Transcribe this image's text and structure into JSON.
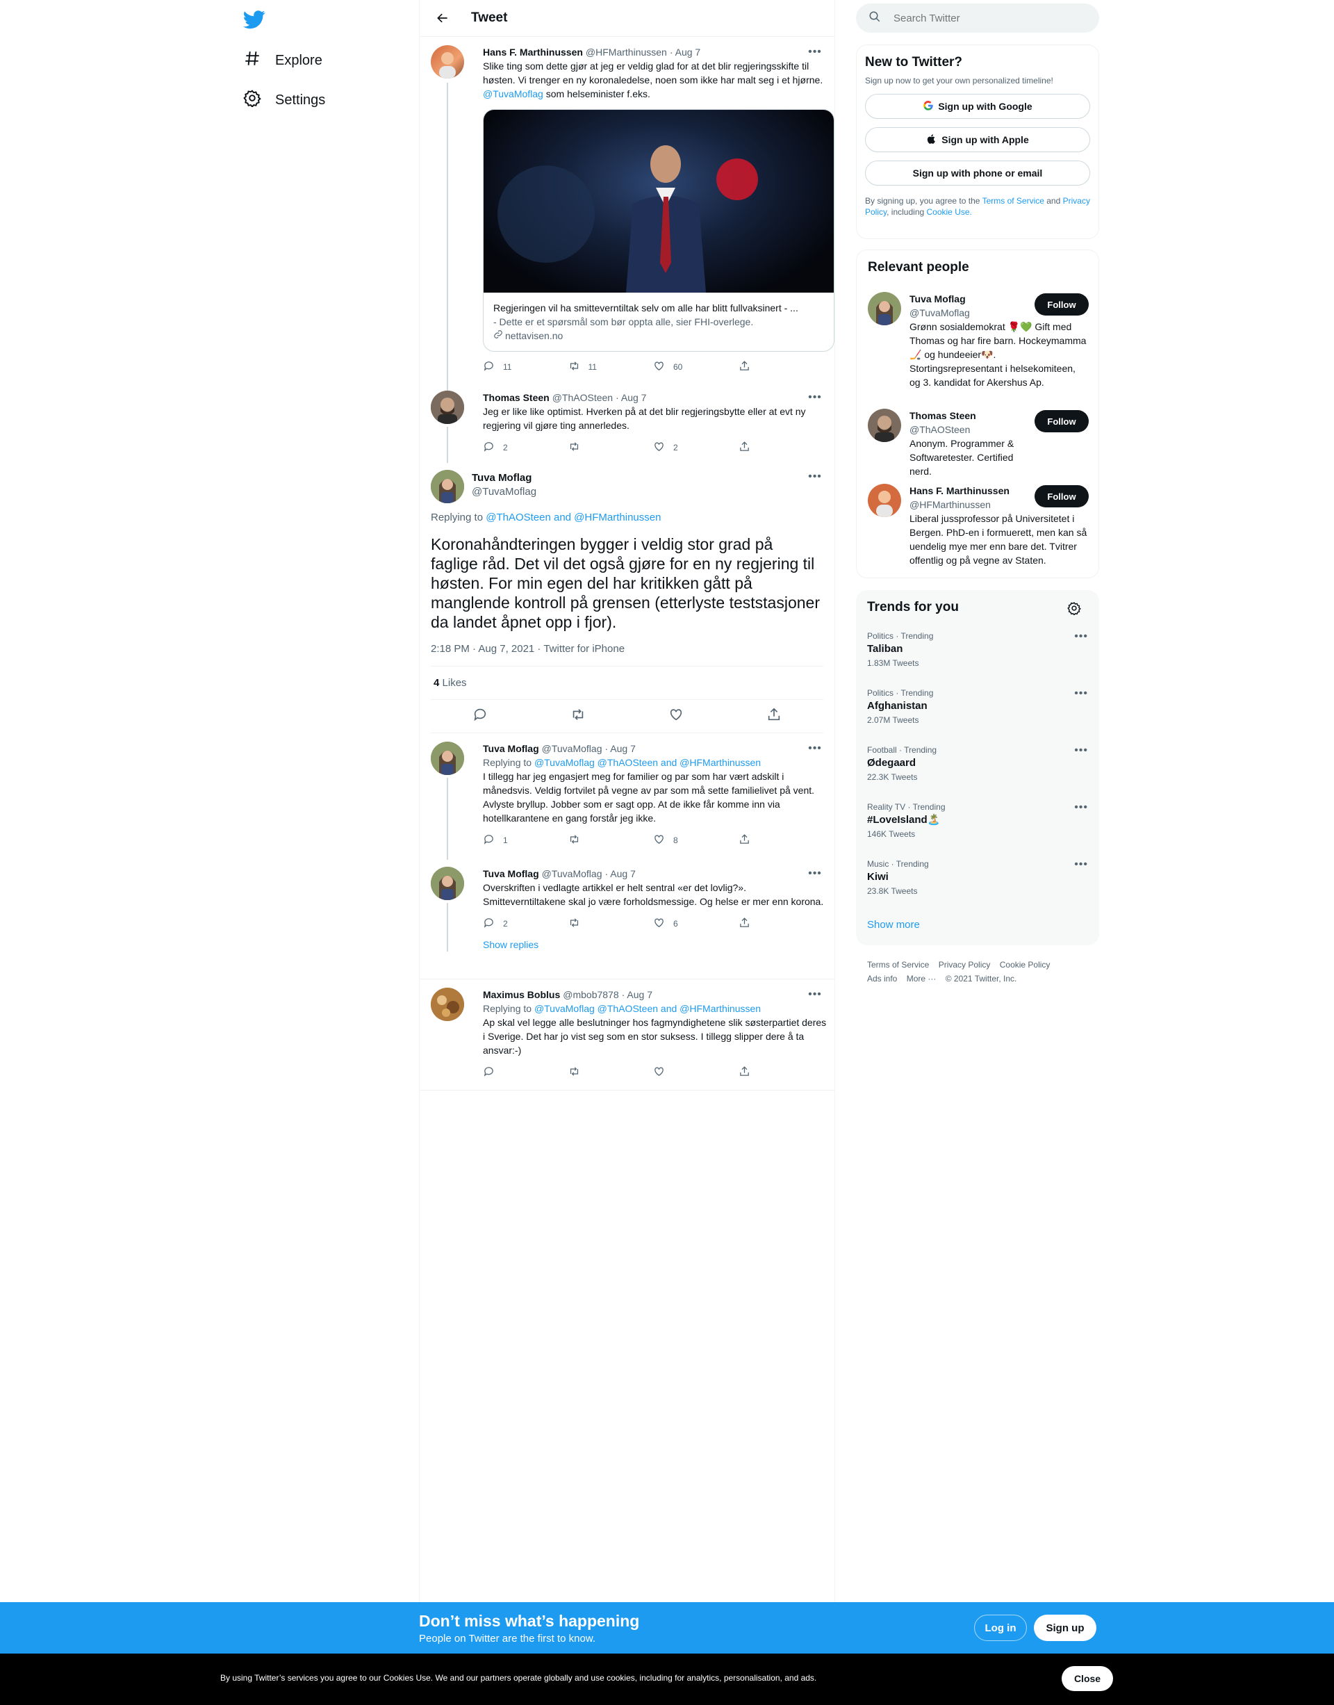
{
  "nav": {
    "explore": "Explore",
    "settings": "Settings"
  },
  "header": {
    "title": "Tweet"
  },
  "tweets": [
    {
      "name": "Hans F. Marthinussen",
      "handle": "@HFMarthinussen",
      "date": "· Aug 7",
      "text_a": "Slike ting som dette gjør at jeg er veldig glad for at det blir regjeringsskifte til høsten. Vi trenger en ny koronaledelse, noen som ikke har malt seg i et hjørne. ",
      "mention": "@TuvaMoflag",
      "text_b": " som helseminister f.eks.",
      "card_title": "Regjeringen vil ha smitteverntiltak selv om alle har blitt fullvaksinert - ...",
      "card_desc": "- Dette er et spørsmål som bør oppta alle, sier FHI-overlege.",
      "card_domain": "nettavisen.no",
      "replies": "11",
      "retweets": "11",
      "likes": "60"
    },
    {
      "name": "Thomas Steen",
      "handle": "@ThAOSteen",
      "date": "· Aug 7",
      "text": "Jeg er like like optimist. Hverken på at det blir regjeringsbytte eller at evt ny regjering vil gjøre ting annerledes.",
      "replies": "2",
      "retweets": "",
      "likes": "2"
    }
  ],
  "focus": {
    "name": "Tuva Moflag",
    "handle": "@TuvaMoflag",
    "replying_label": "Replying to",
    "replying_to": "@ThAOSteen and @HFMarthinussen",
    "text": "Koronahåndteringen bygger i veldig stor grad på faglige råd. Det vil det også gjøre for en ny regjering til høsten. For min egen del har kritikken gått på manglende kontroll på grensen (etterlyste teststasjoner da landet åpnet opp i fjor).",
    "meta": "2:18 PM · Aug 7, 2021 · Twitter for iPhone",
    "likes_count": "4",
    "likes_label": "Likes"
  },
  "replies": [
    {
      "name": "Tuva Moflag",
      "handle": "@TuvaMoflag",
      "date": "· Aug 7",
      "replying_label": "Replying to",
      "replying_to": "@TuvaMoflag @ThAOSteen and @HFMarthinussen",
      "text": "I tillegg har jeg engasjert meg for familier og par som har vært adskilt i månedsvis. Veldig fortvilet på vegne av par som må sette familielivet på vent. Avlyste bryllup. Jobber som er sagt opp. At de ikke får komme inn via hotellkarantene en gang forstår jeg ikke.",
      "replies": "1",
      "retweets": "",
      "likes": "8"
    },
    {
      "name": "Tuva Moflag",
      "handle": "@TuvaMoflag",
      "date": "· Aug 7",
      "text": "Overskriften i vedlagte artikkel er helt sentral «er det lovlig?». Smitteverntiltakene skal jo være forholdsmessige. Og helse er mer enn korona.",
      "replies": "2",
      "retweets": "",
      "likes": "6",
      "show_replies": "Show replies"
    },
    {
      "name": "Maximus Boblus",
      "handle": "@mbob7878",
      "date": "· Aug 7",
      "replying_label": "Replying to",
      "replying_to": "@TuvaMoflag @ThAOSteen and @HFMarthinussen",
      "text": "Ap skal vel legge alle beslutninger hos fagmyndighetene slik søsterpartiet deres i Sverige. Det har jo vist seg som en stor suksess. I tillegg slipper dere å ta ansvar:-)",
      "replies": "",
      "retweets": "",
      "likes": ""
    }
  ],
  "search": {
    "placeholder": "Search Twitter"
  },
  "new_to_twitter": {
    "title": "New to Twitter?",
    "subtitle": "Sign up now to get your own personalized timeline!",
    "google": "Sign up with Google",
    "apple": "Sign up with Apple",
    "phone": "Sign up with phone or email",
    "legal_a": "By signing up, you agree to the ",
    "terms": "Terms of Service",
    "legal_b": " and ",
    "privacy": "Privacy Policy",
    "legal_c": ", including ",
    "cookie": "Cookie Use."
  },
  "relevant": {
    "title": "Relevant people",
    "follow": "Follow",
    "people": [
      {
        "name": "Tuva Moflag",
        "handle": "@TuvaMoflag",
        "bio": "Grønn sosialdemokrat 🌹💚 Gift med Thomas og har fire barn. Hockeymamma🏒 og hundeeier🐶. Stortingsrepresentant i helsekomiteen, og 3. kandidat for Akershus Ap."
      },
      {
        "name": "Thomas Steen",
        "handle": "@ThAOSteen",
        "bio": "Anonym. Programmer & Softwaretester. Certified nerd."
      },
      {
        "name": "Hans F. Marthinussen",
        "handle": "@HFMarthinussen",
        "bio": "Liberal jussprofessor på Universitetet i Bergen. PhD-en i formuerett, men kan så uendelig mye mer enn bare det. Tvitrer offentlig og på vegne av Staten."
      }
    ]
  },
  "trends": {
    "title": "Trends for you",
    "items": [
      {
        "cat": "Politics · Trending",
        "name": "Taliban",
        "count": "1.83M Tweets"
      },
      {
        "cat": "Politics · Trending",
        "name": "Afghanistan",
        "count": "2.07M Tweets"
      },
      {
        "cat": "Football · Trending",
        "name": "Ødegaard",
        "count": "22.3K Tweets"
      },
      {
        "cat": "Reality TV · Trending",
        "name": "#LoveIsland🏝️",
        "count": "146K Tweets"
      },
      {
        "cat": "Music · Trending",
        "name": "Kiwi",
        "count": "23.8K Tweets"
      }
    ],
    "show_more": "Show more"
  },
  "footer": {
    "terms": "Terms of Service",
    "privacy": "Privacy Policy",
    "cookie": "Cookie Policy",
    "ads": "Ads info",
    "more": "More ···",
    "copyright": "© 2021 Twitter, Inc."
  },
  "bottom": {
    "title": "Don’t miss what’s happening",
    "subtitle": "People on Twitter are the first to know.",
    "login": "Log in",
    "signup": "Sign up"
  },
  "cookies": {
    "text": "By using Twitter’s services you agree to our Cookies Use. We and our partners operate globally and use cookies, including for analytics, personalisation, and ads.",
    "close": "Close"
  },
  "colors": {
    "accent": "#1d9bf0",
    "text": "#0f1419",
    "muted": "#536471"
  }
}
